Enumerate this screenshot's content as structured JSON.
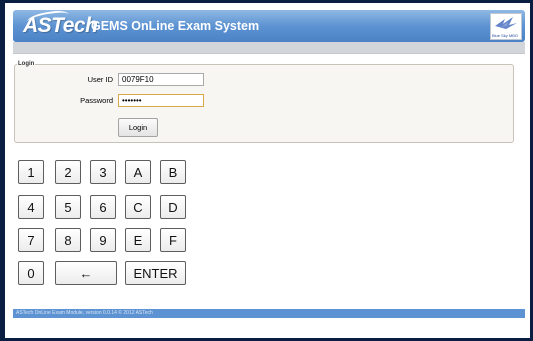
{
  "header": {
    "logo_text": "ASTech",
    "title": "GEMS OnLine Exam System",
    "partner_logo_text": "Blue Sky MBO"
  },
  "login": {
    "legend": "Login",
    "user_id_label": "User ID",
    "user_id_value": "0079F10",
    "password_label": "Password",
    "password_value": "•••••••",
    "button_label": "Login"
  },
  "keypad": {
    "keys": [
      [
        "1",
        "2",
        "3",
        "A",
        "B"
      ],
      [
        "4",
        "5",
        "6",
        "C",
        "D"
      ],
      [
        "7",
        "8",
        "9",
        "E",
        "F"
      ],
      [
        "0",
        "←",
        "ENTER"
      ]
    ]
  },
  "footer": {
    "text": "ASTech OnLine Exam Module, version 0.0.14  © 2012 ASTech"
  },
  "colors": {
    "header_blue": "#5d93d2",
    "background": "#0a1e42",
    "focus_border": "#d9a84a"
  }
}
